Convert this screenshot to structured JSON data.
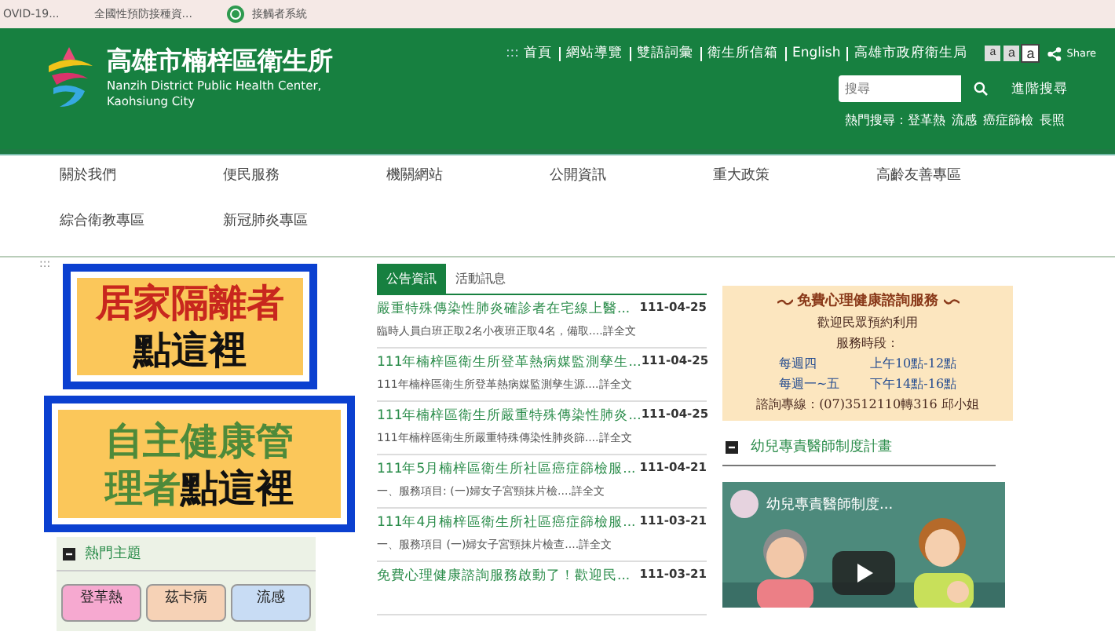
{
  "top_bar": {
    "items": [
      {
        "label": "OVID-19...",
        "kind": "text"
      },
      {
        "label": "全國性預防接種資...",
        "kind": "text"
      },
      {
        "label": "接觸者系統",
        "kind": "icon"
      }
    ]
  },
  "header": {
    "title": "高雄市楠梓區衛生所",
    "subtitle_lines": [
      "Nanzih District Public Health Center,",
      "Kaohsiung City"
    ],
    "accesskey": ":::",
    "links": [
      "首頁",
      "網站導覽",
      "雙語詞彙",
      "衛生所信箱",
      "English",
      "高雄市政府衛生局"
    ],
    "font_sizes": [
      {
        "label": "a",
        "selected": false
      },
      {
        "label": "a",
        "selected": false
      },
      {
        "label": "a",
        "selected": true
      }
    ],
    "share": "Share",
    "search": {
      "placeholder": "搜尋"
    },
    "advanced_search": "進階搜尋",
    "hot_search_label": "熱門搜尋：",
    "hot_search": [
      "登革熱",
      "流感",
      "癌症篩檢",
      "長照"
    ]
  },
  "nav": [
    [
      "關於我們",
      "便民服務",
      "機關網站",
      "公開資訊",
      "重大政策",
      "高齡友善專區"
    ],
    [
      "綜合衛教專區",
      "新冠肺炎專區"
    ]
  ],
  "content_accesskey": ":::",
  "banners": [
    {
      "line1": "居家隔離者",
      "line2": "點這裡",
      "color": "#c8271e"
    },
    {
      "line1": "自主健康管",
      "line2": "點這裡",
      "line2_prefix": "理者",
      "color": "#4e8a3a"
    }
  ],
  "hot_topics": {
    "title": "熱門主題",
    "items": [
      {
        "label": "登革熱",
        "color": "#f6a9d0"
      },
      {
        "label": "茲卡病",
        "color": "#f6d2b6"
      },
      {
        "label": "流感",
        "color": "#c8dcf4"
      }
    ]
  },
  "news": {
    "tabs": [
      {
        "label": "公告資訊",
        "selected": true
      },
      {
        "label": "活動訊息",
        "selected": false
      }
    ],
    "items": [
      {
        "title": "嚴重特殊傳染性肺炎確診者在宅線上醫...",
        "date": "111-04-25",
        "summary": "臨時人員白班正取2名小夜班正取4名，備取....",
        "more": "詳全文"
      },
      {
        "title": "111年楠梓區衛生所登革熱病媒監測孳生...",
        "date": "111-04-25",
        "summary": "111年楠梓區衛生所登革熱病媒監測孳生源....",
        "more": "詳全文"
      },
      {
        "title": "111年楠梓區衛生所嚴重特殊傳染性肺炎...",
        "date": "111-04-25",
        "summary": "111年楠梓區衛生所嚴重特殊傳染性肺炎篩....",
        "more": "詳全文"
      },
      {
        "title": "111年5月楠梓區衛生所社區癌症篩檢服...",
        "date": "111-04-21",
        "summary": "一、服務項目: (一)婦女子宮頸抹片檢....",
        "more": "詳全文"
      },
      {
        "title": "111年4月楠梓區衛生所社區癌症篩檢服...",
        "date": "111-03-21",
        "summary": "一、服務項目 (一)婦女子宮頸抹片檢查....",
        "more": "詳全文"
      },
      {
        "title": "免費心理健康諮詢服務啟動了！歡迎民...",
        "date": "111-03-21"
      }
    ]
  },
  "counseling": {
    "title": "免費心理健康諮詢服務",
    "lines": [
      "歡迎民眾預約利用",
      "服務時段："
    ],
    "schedule": [
      [
        "每週四",
        "上午10點-12點"
      ],
      [
        "每週一~五",
        "下午14點-16點"
      ]
    ],
    "hotline": "諮詢專線：(07)3512110轉316 邱小姐"
  },
  "video_section": {
    "title": "幼兒專責醫師制度計畫",
    "video_title": "幼兒專責醫師制度..."
  }
}
